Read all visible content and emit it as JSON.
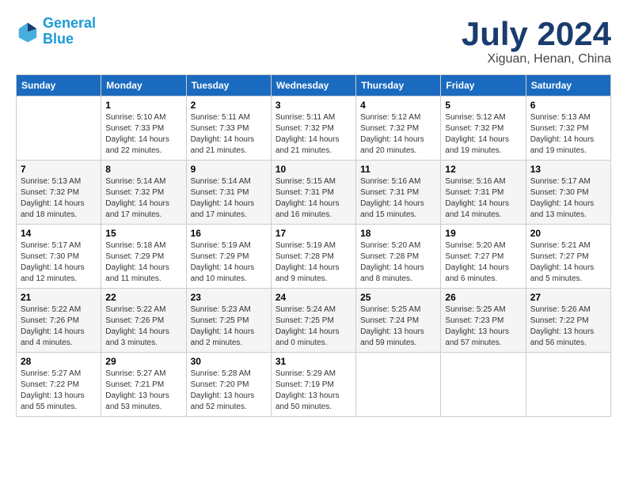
{
  "header": {
    "logo_line1": "General",
    "logo_line2": "Blue",
    "month_year": "July 2024",
    "location": "Xiguan, Henan, China"
  },
  "columns": [
    "Sunday",
    "Monday",
    "Tuesday",
    "Wednesday",
    "Thursday",
    "Friday",
    "Saturday"
  ],
  "weeks": [
    [
      {
        "day": "",
        "sunrise": "",
        "sunset": "",
        "daylight": ""
      },
      {
        "day": "1",
        "sunrise": "Sunrise: 5:10 AM",
        "sunset": "Sunset: 7:33 PM",
        "daylight": "Daylight: 14 hours and 22 minutes."
      },
      {
        "day": "2",
        "sunrise": "Sunrise: 5:11 AM",
        "sunset": "Sunset: 7:33 PM",
        "daylight": "Daylight: 14 hours and 21 minutes."
      },
      {
        "day": "3",
        "sunrise": "Sunrise: 5:11 AM",
        "sunset": "Sunset: 7:32 PM",
        "daylight": "Daylight: 14 hours and 21 minutes."
      },
      {
        "day": "4",
        "sunrise": "Sunrise: 5:12 AM",
        "sunset": "Sunset: 7:32 PM",
        "daylight": "Daylight: 14 hours and 20 minutes."
      },
      {
        "day": "5",
        "sunrise": "Sunrise: 5:12 AM",
        "sunset": "Sunset: 7:32 PM",
        "daylight": "Daylight: 14 hours and 19 minutes."
      },
      {
        "day": "6",
        "sunrise": "Sunrise: 5:13 AM",
        "sunset": "Sunset: 7:32 PM",
        "daylight": "Daylight: 14 hours and 19 minutes."
      }
    ],
    [
      {
        "day": "7",
        "sunrise": "Sunrise: 5:13 AM",
        "sunset": "Sunset: 7:32 PM",
        "daylight": "Daylight: 14 hours and 18 minutes."
      },
      {
        "day": "8",
        "sunrise": "Sunrise: 5:14 AM",
        "sunset": "Sunset: 7:32 PM",
        "daylight": "Daylight: 14 hours and 17 minutes."
      },
      {
        "day": "9",
        "sunrise": "Sunrise: 5:14 AM",
        "sunset": "Sunset: 7:31 PM",
        "daylight": "Daylight: 14 hours and 17 minutes."
      },
      {
        "day": "10",
        "sunrise": "Sunrise: 5:15 AM",
        "sunset": "Sunset: 7:31 PM",
        "daylight": "Daylight: 14 hours and 16 minutes."
      },
      {
        "day": "11",
        "sunrise": "Sunrise: 5:16 AM",
        "sunset": "Sunset: 7:31 PM",
        "daylight": "Daylight: 14 hours and 15 minutes."
      },
      {
        "day": "12",
        "sunrise": "Sunrise: 5:16 AM",
        "sunset": "Sunset: 7:31 PM",
        "daylight": "Daylight: 14 hours and 14 minutes."
      },
      {
        "day": "13",
        "sunrise": "Sunrise: 5:17 AM",
        "sunset": "Sunset: 7:30 PM",
        "daylight": "Daylight: 14 hours and 13 minutes."
      }
    ],
    [
      {
        "day": "14",
        "sunrise": "Sunrise: 5:17 AM",
        "sunset": "Sunset: 7:30 PM",
        "daylight": "Daylight: 14 hours and 12 minutes."
      },
      {
        "day": "15",
        "sunrise": "Sunrise: 5:18 AM",
        "sunset": "Sunset: 7:29 PM",
        "daylight": "Daylight: 14 hours and 11 minutes."
      },
      {
        "day": "16",
        "sunrise": "Sunrise: 5:19 AM",
        "sunset": "Sunset: 7:29 PM",
        "daylight": "Daylight: 14 hours and 10 minutes."
      },
      {
        "day": "17",
        "sunrise": "Sunrise: 5:19 AM",
        "sunset": "Sunset: 7:28 PM",
        "daylight": "Daylight: 14 hours and 9 minutes."
      },
      {
        "day": "18",
        "sunrise": "Sunrise: 5:20 AM",
        "sunset": "Sunset: 7:28 PM",
        "daylight": "Daylight: 14 hours and 8 minutes."
      },
      {
        "day": "19",
        "sunrise": "Sunrise: 5:20 AM",
        "sunset": "Sunset: 7:27 PM",
        "daylight": "Daylight: 14 hours and 6 minutes."
      },
      {
        "day": "20",
        "sunrise": "Sunrise: 5:21 AM",
        "sunset": "Sunset: 7:27 PM",
        "daylight": "Daylight: 14 hours and 5 minutes."
      }
    ],
    [
      {
        "day": "21",
        "sunrise": "Sunrise: 5:22 AM",
        "sunset": "Sunset: 7:26 PM",
        "daylight": "Daylight: 14 hours and 4 minutes."
      },
      {
        "day": "22",
        "sunrise": "Sunrise: 5:22 AM",
        "sunset": "Sunset: 7:26 PM",
        "daylight": "Daylight: 14 hours and 3 minutes."
      },
      {
        "day": "23",
        "sunrise": "Sunrise: 5:23 AM",
        "sunset": "Sunset: 7:25 PM",
        "daylight": "Daylight: 14 hours and 2 minutes."
      },
      {
        "day": "24",
        "sunrise": "Sunrise: 5:24 AM",
        "sunset": "Sunset: 7:25 PM",
        "daylight": "Daylight: 14 hours and 0 minutes."
      },
      {
        "day": "25",
        "sunrise": "Sunrise: 5:25 AM",
        "sunset": "Sunset: 7:24 PM",
        "daylight": "Daylight: 13 hours and 59 minutes."
      },
      {
        "day": "26",
        "sunrise": "Sunrise: 5:25 AM",
        "sunset": "Sunset: 7:23 PM",
        "daylight": "Daylight: 13 hours and 57 minutes."
      },
      {
        "day": "27",
        "sunrise": "Sunrise: 5:26 AM",
        "sunset": "Sunset: 7:22 PM",
        "daylight": "Daylight: 13 hours and 56 minutes."
      }
    ],
    [
      {
        "day": "28",
        "sunrise": "Sunrise: 5:27 AM",
        "sunset": "Sunset: 7:22 PM",
        "daylight": "Daylight: 13 hours and 55 minutes."
      },
      {
        "day": "29",
        "sunrise": "Sunrise: 5:27 AM",
        "sunset": "Sunset: 7:21 PM",
        "daylight": "Daylight: 13 hours and 53 minutes."
      },
      {
        "day": "30",
        "sunrise": "Sunrise: 5:28 AM",
        "sunset": "Sunset: 7:20 PM",
        "daylight": "Daylight: 13 hours and 52 minutes."
      },
      {
        "day": "31",
        "sunrise": "Sunrise: 5:29 AM",
        "sunset": "Sunset: 7:19 PM",
        "daylight": "Daylight: 13 hours and 50 minutes."
      },
      {
        "day": "",
        "sunrise": "",
        "sunset": "",
        "daylight": ""
      },
      {
        "day": "",
        "sunrise": "",
        "sunset": "",
        "daylight": ""
      },
      {
        "day": "",
        "sunrise": "",
        "sunset": "",
        "daylight": ""
      }
    ]
  ]
}
